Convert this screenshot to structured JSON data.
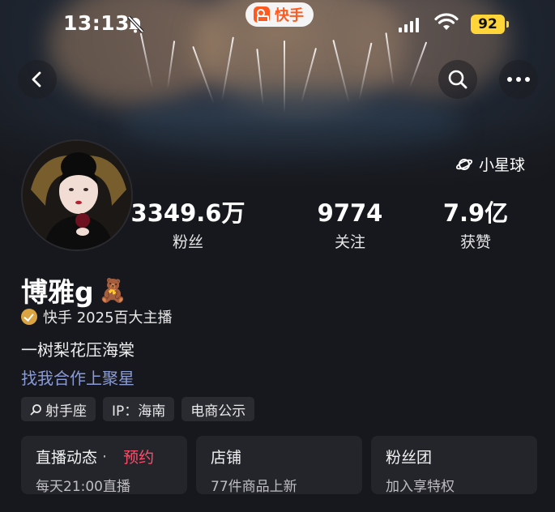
{
  "status_bar": {
    "time": "13:13",
    "battery": "92",
    "app_name": "快手",
    "icons": [
      "bell-muted-icon",
      "signal-icon",
      "wifi-icon",
      "battery-icon"
    ]
  },
  "nav": {
    "back_icon": "chevron-left-icon",
    "search_icon": "search-icon",
    "more_icon": "more-icon"
  },
  "planet": {
    "icon": "planet-icon",
    "label": "小星球"
  },
  "stats": [
    {
      "value": "3349.6万",
      "label": "粉丝"
    },
    {
      "value": "9774",
      "label": "关注"
    },
    {
      "value": "7.9亿",
      "label": "获赞"
    }
  ],
  "profile": {
    "name": "博雅g",
    "emoji": "🧸",
    "badge_text": "快手 2025百大主播",
    "bio": "一树梨花压海棠",
    "link": "找我合作上聚星"
  },
  "tags": [
    {
      "icon": "search-icon",
      "label": "射手座"
    },
    {
      "label": "IP：海南"
    },
    {
      "label": "电商公示"
    }
  ],
  "cards": {
    "live": {
      "title": "直播动态",
      "separator": "·",
      "accent": "预约",
      "subtitle": "每天21:00直播"
    },
    "shop": {
      "title": "店铺",
      "subtitle": "77件商品上新"
    },
    "fans": {
      "title": "粉丝团",
      "subtitle": "加入享特权"
    }
  },
  "colors": {
    "background": "#17181d",
    "accent": "#ff4d6a",
    "link": "#8a9bd6",
    "brand": "#ff5a1f",
    "battery": "#ffd53a"
  }
}
